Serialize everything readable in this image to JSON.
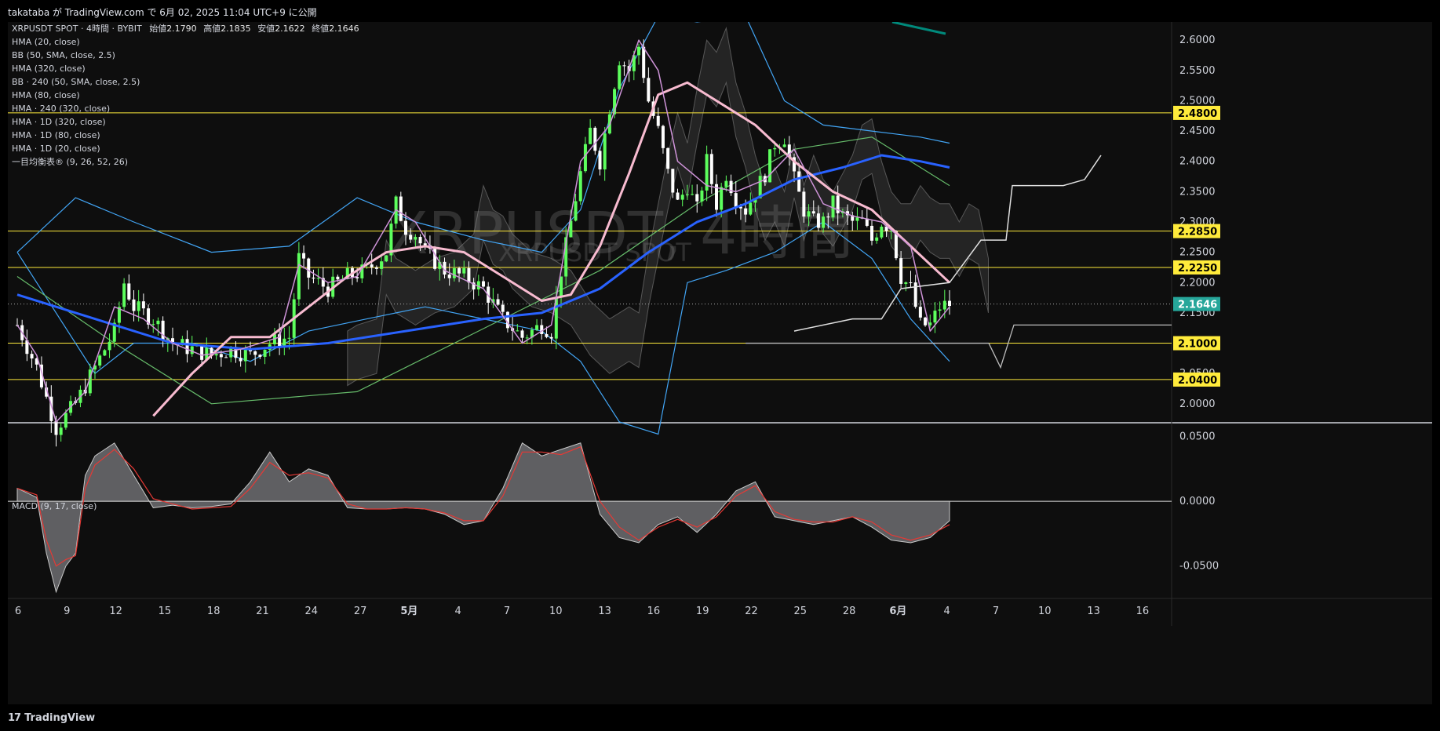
{
  "header": {
    "text": "takataba が TradingView.com で 6月 02, 2025 11:04 UTC+9 に公開"
  },
  "legend": {
    "symbol_line": "XRPUSDT SPOT · 4時間 · BYBIT",
    "ohlc": [
      {
        "label": "始値",
        "value": "2.1790"
      },
      {
        "label": "高値",
        "value": "2.1835"
      },
      {
        "label": "安値",
        "value": "2.1622"
      },
      {
        "label": "終値",
        "value": "2.1646"
      }
    ],
    "indicators": [
      "HMA (20, close)",
      "BB (50, SMA, close, 2.5)",
      "HMA (320, close)",
      "BB · 240 (50, SMA, close, 2.5)",
      "HMA (80, close)",
      "HMA · 240 (320, close)",
      "HMA · 1D (320, close)",
      "HMA · 1D (80, close)",
      "HMA · 1D (20, close)",
      "一目均衡表® (9, 26, 52, 26)"
    ],
    "macd_label": "MACD (9, 17, close)"
  },
  "watermark": {
    "title": "XRPUSDT, 4時間",
    "subtitle": "XRPUSDT SPOT"
  },
  "footer": {
    "logo_mark": "17",
    "logo_text": "TradingView"
  },
  "colors": {
    "bg": "#0e0e0e",
    "up": "#5dff5d",
    "down": "#ffffff",
    "hline": "#ffeb3b",
    "hma320": "#2962ff",
    "hma80": "#f8bbd0",
    "hma20": "#ce93d8",
    "bb": "#42a5f5",
    "bb240": "#66bb6a",
    "macd_signal": "#e53935"
  },
  "chart_data": [
    {
      "type": "candlestick",
      "title": "XRPUSDT SPOT · 4時間 · BYBIT",
      "x_tick_labels": [
        "6",
        "9",
        "12",
        "15",
        "18",
        "21",
        "24",
        "27",
        "5月",
        "4",
        "7",
        "10",
        "13",
        "16",
        "19",
        "22",
        "25",
        "28",
        "6月",
        "4",
        "7",
        "10",
        "13",
        "16"
      ],
      "y_tick_labels": [
        "2.6000",
        "2.5500",
        "2.5000",
        "2.4500",
        "2.4000",
        "2.3500",
        "2.3000",
        "2.2500",
        "2.2000",
        "2.1500",
        "2.1000",
        "2.0500",
        "2.0000"
      ],
      "ylim": [
        1.97,
        2.63
      ],
      "horizontal_levels": [
        2.48,
        2.285,
        2.225,
        2.1,
        2.04
      ],
      "current_price": 2.1646,
      "last_candle": {
        "open": 2.179,
        "high": 2.1835,
        "low": 2.1622,
        "close": 2.1646
      },
      "close_path": [
        [
          0,
          2.13
        ],
        [
          4,
          2.06
        ],
        [
          8,
          1.96
        ],
        [
          12,
          2.0
        ],
        [
          16,
          2.06
        ],
        [
          20,
          2.12
        ],
        [
          22,
          2.2
        ],
        [
          24,
          2.16
        ],
        [
          28,
          2.14
        ],
        [
          32,
          2.1
        ],
        [
          36,
          2.09
        ],
        [
          40,
          2.08
        ],
        [
          44,
          2.09
        ],
        [
          48,
          2.08
        ],
        [
          52,
          2.1
        ],
        [
          56,
          2.11
        ],
        [
          58,
          2.24
        ],
        [
          60,
          2.21
        ],
        [
          64,
          2.19
        ],
        [
          68,
          2.21
        ],
        [
          72,
          2.22
        ],
        [
          76,
          2.25
        ],
        [
          78,
          2.33
        ],
        [
          80,
          2.29
        ],
        [
          82,
          2.28
        ],
        [
          84,
          2.25
        ],
        [
          88,
          2.22
        ],
        [
          92,
          2.21
        ],
        [
          96,
          2.19
        ],
        [
          100,
          2.14
        ],
        [
          104,
          2.11
        ],
        [
          108,
          2.13
        ],
        [
          110,
          2.12
        ],
        [
          112,
          2.22
        ],
        [
          114,
          2.3
        ],
        [
          116,
          2.38
        ],
        [
          118,
          2.45
        ],
        [
          120,
          2.4
        ],
        [
          122,
          2.49
        ],
        [
          124,
          2.57
        ],
        [
          126,
          2.55
        ],
        [
          128,
          2.59
        ],
        [
          130,
          2.5
        ],
        [
          132,
          2.45
        ],
        [
          134,
          2.38
        ],
        [
          136,
          2.33
        ],
        [
          138,
          2.36
        ],
        [
          140,
          2.32
        ],
        [
          142,
          2.4
        ],
        [
          144,
          2.33
        ],
        [
          146,
          2.38
        ],
        [
          148,
          2.34
        ],
        [
          150,
          2.32
        ],
        [
          152,
          2.35
        ],
        [
          154,
          2.38
        ],
        [
          156,
          2.43
        ],
        [
          158,
          2.44
        ],
        [
          160,
          2.37
        ],
        [
          162,
          2.32
        ],
        [
          164,
          2.3
        ],
        [
          166,
          2.3
        ],
        [
          168,
          2.33
        ],
        [
          170,
          2.31
        ],
        [
          172,
          2.3
        ],
        [
          174,
          2.3
        ],
        [
          176,
          2.27
        ],
        [
          178,
          2.3
        ],
        [
          180,
          2.29
        ],
        [
          182,
          2.21
        ],
        [
          184,
          2.19
        ],
        [
          186,
          2.13
        ],
        [
          188,
          2.13
        ],
        [
          190,
          2.16
        ],
        [
          192,
          2.1646
        ]
      ],
      "overlays": [
        {
          "name": "HMA (320, close)",
          "points": [
            [
              0,
              2.18
            ],
            [
              16,
              2.14
            ],
            [
              32,
              2.1
            ],
            [
              48,
              2.09
            ],
            [
              64,
              2.1
            ],
            [
              80,
              2.12
            ],
            [
              96,
              2.14
            ],
            [
              108,
              2.15
            ],
            [
              120,
              2.19
            ],
            [
              130,
              2.25
            ],
            [
              140,
              2.3
            ],
            [
              150,
              2.33
            ],
            [
              160,
              2.37
            ],
            [
              170,
              2.39
            ],
            [
              178,
              2.41
            ],
            [
              186,
              2.4
            ],
            [
              192,
              2.39
            ]
          ]
        },
        {
          "name": "HMA (80, close)",
          "points": [
            [
              28,
              1.98
            ],
            [
              36,
              2.05
            ],
            [
              44,
              2.11
            ],
            [
              52,
              2.11
            ],
            [
              60,
              2.16
            ],
            [
              68,
              2.21
            ],
            [
              76,
              2.25
            ],
            [
              84,
              2.26
            ],
            [
              92,
              2.25
            ],
            [
              100,
              2.21
            ],
            [
              108,
              2.17
            ],
            [
              114,
              2.18
            ],
            [
              120,
              2.26
            ],
            [
              126,
              2.38
            ],
            [
              132,
              2.51
            ],
            [
              138,
              2.53
            ],
            [
              146,
              2.49
            ],
            [
              152,
              2.46
            ],
            [
              160,
              2.4
            ],
            [
              168,
              2.35
            ],
            [
              176,
              2.32
            ],
            [
              184,
              2.26
            ],
            [
              192,
              2.2
            ]
          ]
        },
        {
          "name": "HMA (20, close)",
          "points": [
            [
              0,
              2.13
            ],
            [
              4,
              2.08
            ],
            [
              8,
              1.97
            ],
            [
              14,
              2.02
            ],
            [
              20,
              2.16
            ],
            [
              26,
              2.14
            ],
            [
              32,
              2.1
            ],
            [
              38,
              2.08
            ],
            [
              46,
              2.09
            ],
            [
              54,
              2.11
            ],
            [
              58,
              2.23
            ],
            [
              64,
              2.2
            ],
            [
              70,
              2.21
            ],
            [
              78,
              2.32
            ],
            [
              82,
              2.3
            ],
            [
              88,
              2.22
            ],
            [
              96,
              2.19
            ],
            [
              104,
              2.1
            ],
            [
              110,
              2.13
            ],
            [
              116,
              2.4
            ],
            [
              122,
              2.46
            ],
            [
              128,
              2.6
            ],
            [
              132,
              2.55
            ],
            [
              136,
              2.4
            ],
            [
              142,
              2.36
            ],
            [
              148,
              2.35
            ],
            [
              154,
              2.37
            ],
            [
              160,
              2.42
            ],
            [
              166,
              2.33
            ],
            [
              172,
              2.31
            ],
            [
              178,
              2.3
            ],
            [
              184,
              2.26
            ],
            [
              188,
              2.12
            ],
            [
              192,
              2.16
            ]
          ]
        },
        {
          "name": "BB (50, SMA, close, 2.5) upper",
          "points": [
            [
              0,
              2.25
            ],
            [
              12,
              2.34
            ],
            [
              24,
              2.3
            ],
            [
              40,
              2.25
            ],
            [
              56,
              2.26
            ],
            [
              70,
              2.34
            ],
            [
              82,
              2.3
            ],
            [
              96,
              2.27
            ],
            [
              108,
              2.25
            ],
            [
              116,
              2.32
            ],
            [
              124,
              2.52
            ],
            [
              132,
              2.64
            ],
            [
              140,
              2.63
            ],
            [
              150,
              2.64
            ],
            [
              158,
              2.5
            ],
            [
              166,
              2.46
            ],
            [
              176,
              2.45
            ],
            [
              186,
              2.44
            ],
            [
              192,
              2.43
            ]
          ]
        },
        {
          "name": "BB (50, SMA, close, 2.5) lower",
          "points": [
            [
              0,
              2.25
            ],
            [
              8,
              2.15
            ],
            [
              16,
              2.05
            ],
            [
              24,
              2.1
            ],
            [
              36,
              2.1
            ],
            [
              48,
              2.07
            ],
            [
              60,
              2.12
            ],
            [
              72,
              2.14
            ],
            [
              84,
              2.16
            ],
            [
              96,
              2.14
            ],
            [
              108,
              2.12
            ],
            [
              116,
              2.07
            ],
            [
              124,
              1.97
            ],
            [
              132,
              1.95
            ],
            [
              138,
              2.2
            ],
            [
              146,
              2.22
            ],
            [
              156,
              2.25
            ],
            [
              166,
              2.3
            ],
            [
              176,
              2.24
            ],
            [
              184,
              2.14
            ],
            [
              192,
              2.07
            ]
          ]
        }
      ]
    },
    {
      "type": "area",
      "title": "MACD (9, 17, close)",
      "y_tick_labels": [
        "0.0500",
        "0.0000",
        "-0.0500"
      ],
      "ylim": [
        -0.075,
        0.06
      ],
      "x": [
        0,
        4,
        6,
        8,
        10,
        12,
        14,
        16,
        20,
        24,
        28,
        32,
        36,
        40,
        44,
        48,
        52,
        56,
        60,
        64,
        68,
        72,
        76,
        80,
        84,
        88,
        92,
        96,
        100,
        104,
        108,
        112,
        116,
        120,
        124,
        128,
        132,
        136,
        140,
        144,
        148,
        152,
        156,
        160,
        164,
        168,
        172,
        176,
        180,
        184,
        188,
        192
      ],
      "series": [
        {
          "name": "MACD",
          "values": [
            0.01,
            0.003,
            -0.04,
            -0.07,
            -0.05,
            -0.04,
            0.02,
            0.035,
            0.045,
            0.02,
            -0.005,
            -0.003,
            -0.005,
            -0.004,
            -0.002,
            0.015,
            0.038,
            0.015,
            0.025,
            0.02,
            -0.005,
            -0.006,
            -0.006,
            -0.005,
            -0.006,
            -0.01,
            -0.018,
            -0.015,
            0.01,
            0.045,
            0.035,
            0.04,
            0.045,
            -0.01,
            -0.028,
            -0.032,
            -0.018,
            -0.012,
            -0.024,
            -0.01,
            0.008,
            0.015,
            -0.012,
            -0.015,
            -0.018,
            -0.015,
            -0.012,
            -0.02,
            -0.03,
            -0.032,
            -0.028,
            -0.015
          ]
        },
        {
          "name": "Signal",
          "values": [
            0.01,
            0.005,
            -0.03,
            -0.05,
            -0.045,
            -0.042,
            0.01,
            0.028,
            0.04,
            0.025,
            0.002,
            -0.002,
            -0.006,
            -0.005,
            -0.004,
            0.01,
            0.03,
            0.02,
            0.022,
            0.018,
            -0.002,
            -0.006,
            -0.006,
            -0.005,
            -0.006,
            -0.009,
            -0.015,
            -0.015,
            0.004,
            0.038,
            0.038,
            0.036,
            0.042,
            0.0,
            -0.02,
            -0.03,
            -0.02,
            -0.014,
            -0.02,
            -0.012,
            0.004,
            0.012,
            -0.008,
            -0.014,
            -0.016,
            -0.016,
            -0.012,
            -0.016,
            -0.026,
            -0.03,
            -0.026,
            -0.018
          ]
        }
      ]
    }
  ]
}
